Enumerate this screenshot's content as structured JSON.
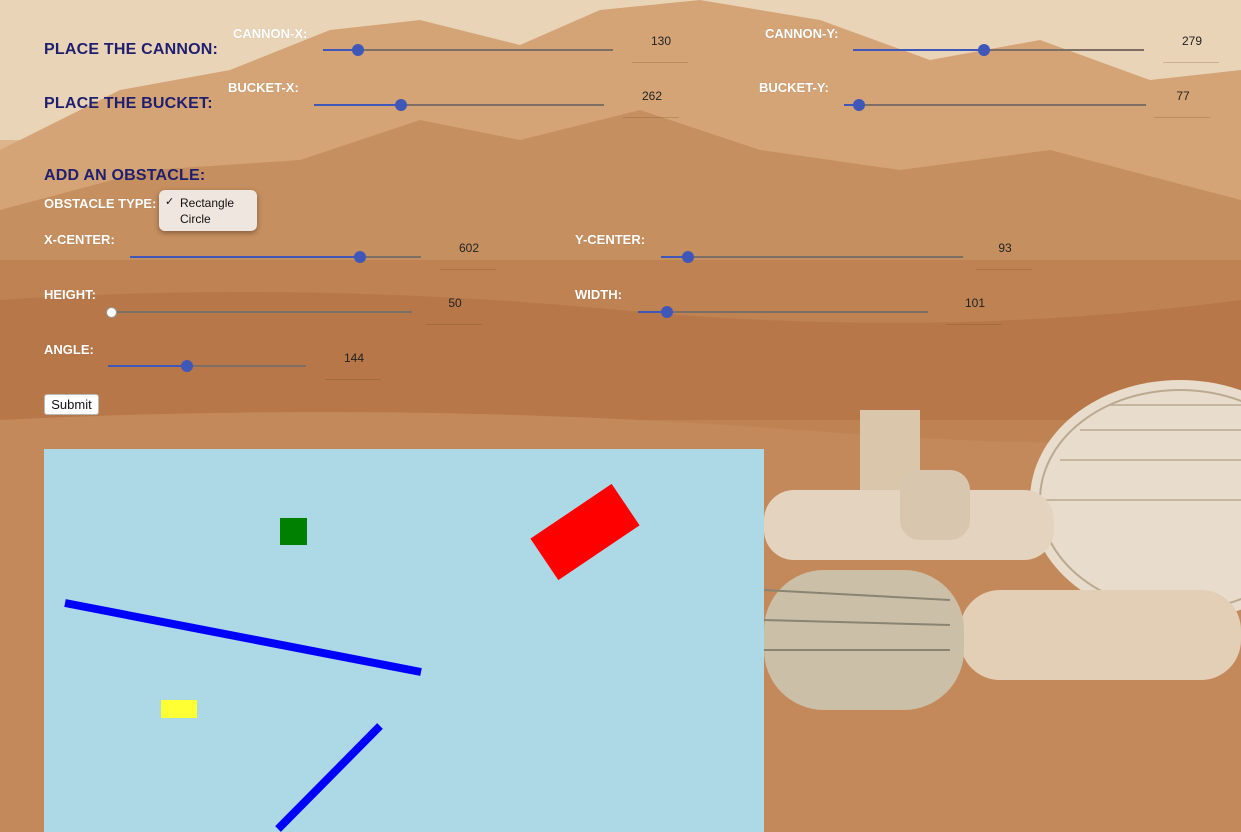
{
  "cannon": {
    "heading": "PLACE THE CANNON:",
    "x_label": "CANNON-X:",
    "x_value": "130",
    "y_label": "CANNON-Y:",
    "y_value": "279"
  },
  "bucket": {
    "heading": "PLACE THE BUCKET:",
    "x_label": "BUCKET-X:",
    "x_value": "262",
    "y_label": "BUCKET-Y:",
    "y_value": "77"
  },
  "obstacle": {
    "heading": "ADD AN OBSTACLE:",
    "type_label": "OBSTACLE TYPE:",
    "type_options": [
      "Rectangle",
      "Circle"
    ],
    "type_selected": "Rectangle",
    "xcenter_label": "X-CENTER:",
    "xcenter_value": "602",
    "ycenter_label": "Y-CENTER:",
    "ycenter_value": "93",
    "height_label": "HEIGHT:",
    "height_value": "50",
    "width_label": "WIDTH:",
    "width_value": "101",
    "angle_label": "ANGLE:",
    "angle_value": "144",
    "submit_label": "Submit"
  },
  "slider_levels": {
    "cannon_x": 0.12,
    "cannon_y": 0.45,
    "bucket_x": 0.3,
    "bucket_y": 0.05,
    "xcenter": 0.79,
    "ycenter": 0.09,
    "height": 0.0,
    "width": 0.1,
    "angle": 0.4
  },
  "colors": {
    "heading": "#1f1f6e",
    "slider_accent": "#3f57b8",
    "canvas_bg": "#add8e6",
    "line": "#0000ff",
    "obstacle": "#ff0000",
    "cannon": "#008000",
    "bucket": "#ffff33"
  }
}
